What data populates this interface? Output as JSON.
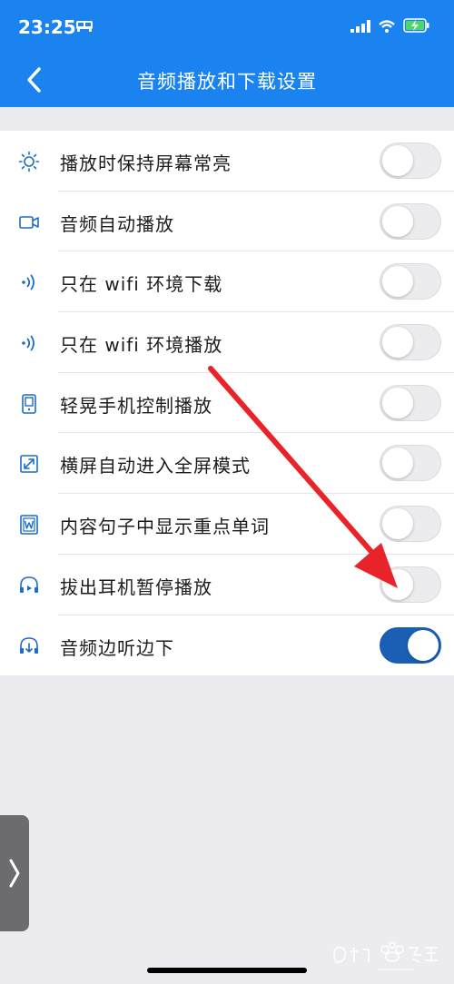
{
  "status_bar": {
    "time": "23:25"
  },
  "header": {
    "title": "音频播放和下载设置"
  },
  "settings": [
    {
      "label": "播放时保持屏幕常亮",
      "icon": "brightness-icon",
      "enabled": false
    },
    {
      "label": "音频自动播放",
      "icon": "video-camera-icon",
      "enabled": false
    },
    {
      "label": "只在 wifi 环境下载",
      "icon": "signal-waves-icon",
      "enabled": false
    },
    {
      "label": "只在 wifi 环境播放",
      "icon": "signal-waves-icon",
      "enabled": false
    },
    {
      "label": "轻晃手机控制播放",
      "icon": "phone-icon",
      "enabled": false
    },
    {
      "label": "横屏自动进入全屏模式",
      "icon": "expand-icon",
      "enabled": false
    },
    {
      "label": "内容句子中显示重点单词",
      "icon": "word-card-icon",
      "enabled": false
    },
    {
      "label": "拔出耳机暂停播放",
      "icon": "headphone-play-icon",
      "enabled": false
    },
    {
      "label": "音频边听边下",
      "icon": "headphone-download-icon",
      "enabled": true
    }
  ],
  "colors": {
    "header_bg": "#1a83ef",
    "toggle_on": "#1a5fb4",
    "icon_blue": "#1a6dc8",
    "annotation_arrow": "#e8232a"
  }
}
